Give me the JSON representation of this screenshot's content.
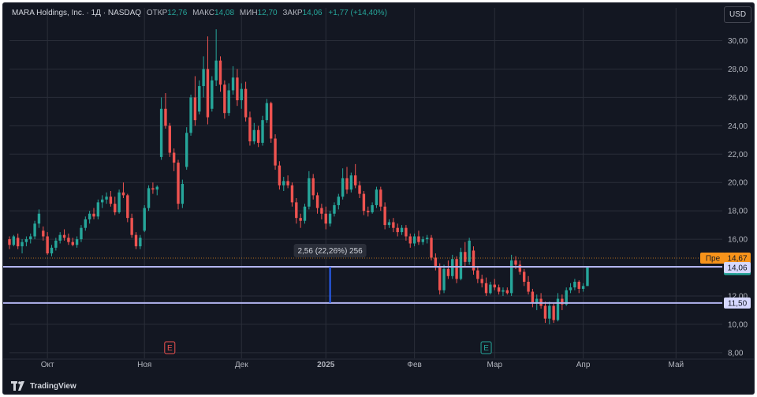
{
  "legend": {
    "name": "MARA Holdings, Inc.",
    "interval": "1Д",
    "exchange": "NASDAQ",
    "open_label": "ОТКР",
    "open": "12,76",
    "high_label": "МАКС",
    "high": "14,08",
    "low_label": "МИН",
    "low": "12,70",
    "close_label": "ЗАКР",
    "close": "14,06",
    "change": "+1,77 (+14,40%)"
  },
  "currency_button": "USD",
  "footer": {
    "brand": "TradingView",
    "icon": "tradingview-logo-icon"
  },
  "colors": {
    "background": "#131722",
    "up": "#26a69a",
    "down": "#ef5350",
    "level_line": "#b2b5f0",
    "measure": "#2962ff",
    "premarket": "#f7931a",
    "grid": "#2a2e39"
  },
  "chart_data": {
    "type": "candlestick",
    "title": "MARA Holdings, Inc. · 1Д · NASDAQ",
    "y_axis": {
      "range": [
        7.6,
        31.2
      ],
      "ticks": [
        "8,00",
        "10,00",
        "12,00",
        "14,00",
        "16,00",
        "18,00",
        "20,00",
        "22,00",
        "24,00",
        "26,00",
        "28,00",
        "30,00"
      ],
      "tick_values": [
        8,
        10,
        12,
        14,
        16,
        18,
        20,
        22,
        24,
        26,
        28,
        30
      ]
    },
    "x_axis": {
      "labels": [
        {
          "text": "Окт",
          "bar": 9,
          "bold": false
        },
        {
          "text": "Ноя",
          "bar": 32,
          "bold": false
        },
        {
          "text": "Дек",
          "bar": 55,
          "bold": false
        },
        {
          "text": "2025",
          "bar": 75,
          "bold": true
        },
        {
          "text": "Фев",
          "bar": 96,
          "bold": false
        },
        {
          "text": "Мар",
          "bar": 115,
          "bold": false
        },
        {
          "text": "Апр",
          "bar": 136,
          "bold": false
        },
        {
          "text": "Май",
          "bar": 158,
          "bold": false
        }
      ],
      "bars_total": 165
    },
    "candles": [
      [
        16.0,
        16.2,
        15.3,
        15.6
      ],
      [
        15.6,
        16.3,
        15.5,
        16.2
      ],
      [
        16.1,
        16.4,
        15.3,
        15.5
      ],
      [
        15.5,
        16.0,
        15.0,
        15.8
      ],
      [
        15.8,
        16.2,
        15.5,
        16.0
      ],
      [
        16.0,
        16.4,
        15.7,
        16.2
      ],
      [
        16.2,
        17.3,
        16.0,
        17.1
      ],
      [
        17.1,
        18.1,
        16.8,
        17.8
      ],
      [
        16.6,
        16.9,
        15.9,
        16.2
      ],
      [
        16.2,
        16.5,
        14.9,
        15.0
      ],
      [
        15.0,
        15.6,
        14.8,
        15.4
      ],
      [
        15.4,
        16.1,
        15.2,
        15.9
      ],
      [
        15.9,
        16.5,
        15.7,
        16.3
      ],
      [
        16.3,
        16.7,
        15.9,
        16.1
      ],
      [
        16.1,
        16.4,
        15.6,
        15.8
      ],
      [
        15.8,
        16.1,
        15.5,
        15.6
      ],
      [
        15.6,
        16.2,
        15.4,
        16.0
      ],
      [
        16.0,
        17.0,
        15.8,
        16.8
      ],
      [
        16.8,
        17.6,
        16.6,
        17.4
      ],
      [
        17.4,
        18.0,
        17.1,
        17.8
      ],
      [
        17.8,
        18.2,
        17.4,
        17.6
      ],
      [
        17.6,
        18.8,
        17.4,
        18.6
      ],
      [
        18.6,
        19.1,
        18.2,
        18.8
      ],
      [
        18.8,
        19.3,
        18.5,
        19.0
      ],
      [
        19.0,
        19.4,
        18.3,
        18.5
      ],
      [
        18.5,
        19.0,
        17.7,
        17.9
      ],
      [
        17.9,
        19.5,
        17.8,
        19.3
      ],
      [
        19.3,
        20.0,
        18.9,
        19.1
      ],
      [
        19.1,
        19.2,
        17.2,
        17.5
      ],
      [
        17.5,
        17.8,
        16.1,
        16.3
      ],
      [
        16.3,
        16.5,
        15.3,
        15.5
      ],
      [
        15.5,
        16.3,
        15.3,
        16.1
      ],
      [
        16.6,
        18.4,
        16.5,
        18.2
      ],
      [
        18.2,
        19.8,
        18.0,
        19.6
      ],
      [
        19.6,
        20.0,
        19.2,
        19.5
      ],
      [
        19.5,
        19.8,
        19.1,
        19.7
      ],
      [
        21.8,
        26.0,
        21.6,
        25.2
      ],
      [
        25.2,
        26.3,
        23.8,
        24.0
      ],
      [
        24.0,
        24.2,
        21.8,
        22.1
      ],
      [
        22.1,
        22.4,
        20.8,
        21.4
      ],
      [
        21.4,
        21.6,
        18.1,
        18.5
      ],
      [
        18.5,
        20.2,
        18.2,
        19.9
      ],
      [
        21.1,
        23.9,
        20.9,
        23.5
      ],
      [
        23.5,
        26.2,
        23.3,
        26.0
      ],
      [
        26.0,
        27.5,
        24.0,
        24.4
      ],
      [
        25.0,
        27.2,
        24.8,
        26.8
      ],
      [
        26.8,
        28.9,
        26.0,
        28.0
      ],
      [
        28.0,
        30.3,
        24.1,
        24.6
      ],
      [
        25.2,
        27.5,
        25.0,
        27.2
      ],
      [
        27.2,
        30.8,
        26.8,
        28.6
      ],
      [
        28.6,
        28.9,
        26.4,
        26.9
      ],
      [
        26.9,
        27.2,
        24.5,
        24.9
      ],
      [
        24.9,
        27.0,
        24.7,
        26.5
      ],
      [
        26.5,
        28.2,
        26.2,
        27.4
      ],
      [
        27.4,
        28.0,
        25.4,
        25.8
      ],
      [
        25.8,
        27.0,
        25.2,
        26.6
      ],
      [
        26.6,
        27.1,
        24.3,
        24.6
      ],
      [
        24.6,
        25.0,
        22.6,
        22.9
      ],
      [
        22.9,
        24.2,
        22.7,
        23.7
      ],
      [
        23.7,
        24.0,
        22.5,
        22.8
      ],
      [
        22.8,
        24.7,
        22.6,
        24.4
      ],
      [
        24.4,
        25.9,
        24.2,
        25.6
      ],
      [
        25.6,
        25.7,
        22.8,
        23.1
      ],
      [
        23.1,
        23.4,
        20.9,
        21.2
      ],
      [
        21.2,
        21.5,
        19.5,
        19.8
      ],
      [
        19.8,
        20.4,
        19.4,
        20.1
      ],
      [
        20.1,
        20.5,
        19.6,
        19.8
      ],
      [
        19.8,
        20.0,
        18.3,
        18.6
      ],
      [
        18.6,
        18.9,
        17.1,
        17.5
      ],
      [
        17.5,
        17.8,
        16.8,
        17.3
      ],
      [
        17.3,
        18.5,
        17.1,
        18.3
      ],
      [
        18.3,
        20.8,
        18.1,
        20.3
      ],
      [
        20.3,
        20.6,
        18.8,
        19.1
      ],
      [
        19.1,
        19.3,
        17.8,
        18.2
      ],
      [
        18.2,
        18.5,
        17.4,
        17.8
      ],
      [
        17.8,
        18.3,
        16.7,
        17.1
      ],
      [
        17.1,
        18.0,
        16.9,
        17.8
      ],
      [
        17.8,
        18.6,
        17.6,
        18.4
      ],
      [
        18.4,
        19.2,
        18.1,
        19.0
      ],
      [
        19.0,
        21.0,
        18.8,
        20.3
      ],
      [
        20.3,
        21.1,
        19.2,
        19.5
      ],
      [
        19.5,
        20.7,
        19.3,
        20.5
      ],
      [
        20.5,
        21.3,
        19.6,
        19.8
      ],
      [
        19.8,
        20.1,
        18.9,
        19.2
      ],
      [
        19.2,
        19.4,
        17.7,
        18.0
      ],
      [
        18.0,
        18.3,
        17.6,
        17.9
      ],
      [
        17.9,
        18.6,
        17.8,
        18.4
      ],
      [
        18.4,
        19.7,
        18.2,
        19.5
      ],
      [
        19.5,
        19.7,
        18.0,
        18.3
      ],
      [
        18.3,
        18.6,
        16.7,
        17.0
      ],
      [
        17.0,
        17.4,
        16.8,
        17.2
      ],
      [
        17.2,
        17.5,
        16.5,
        16.8
      ],
      [
        16.8,
        17.1,
        16.2,
        16.5
      ],
      [
        16.5,
        17.0,
        16.3,
        16.8
      ],
      [
        16.8,
        17.0,
        15.9,
        16.2
      ],
      [
        16.2,
        16.4,
        15.4,
        15.7
      ],
      [
        15.7,
        16.4,
        15.5,
        16.2
      ],
      [
        16.2,
        16.6,
        15.6,
        15.8
      ],
      [
        15.8,
        16.2,
        15.6,
        16.0
      ],
      [
        16.0,
        16.3,
        15.7,
        16.1
      ],
      [
        16.1,
        16.3,
        14.5,
        14.7
      ],
      [
        14.7,
        15.0,
        13.8,
        14.1
      ],
      [
        14.1,
        14.3,
        12.1,
        12.4
      ],
      [
        12.4,
        14.2,
        12.2,
        13.9
      ],
      [
        13.9,
        14.5,
        13.2,
        13.4
      ],
      [
        13.4,
        14.9,
        13.2,
        14.6
      ],
      [
        14.6,
        14.8,
        12.9,
        13.2
      ],
      [
        13.2,
        15.4,
        13.1,
        15.1
      ],
      [
        15.1,
        15.8,
        14.1,
        14.4
      ],
      [
        14.4,
        16.1,
        14.2,
        15.9
      ],
      [
        15.2,
        15.5,
        13.5,
        13.8
      ],
      [
        13.8,
        14.0,
        12.9,
        13.2
      ],
      [
        13.2,
        13.5,
        12.6,
        12.9
      ],
      [
        12.9,
        13.3,
        12.0,
        12.2
      ],
      [
        12.2,
        13.0,
        12.1,
        12.8
      ],
      [
        12.8,
        13.2,
        12.4,
        12.6
      ],
      [
        12.6,
        12.8,
        12.1,
        12.3
      ],
      [
        12.3,
        12.6,
        12.0,
        12.4
      ],
      [
        12.4,
        12.6,
        12.1,
        12.2
      ],
      [
        12.2,
        14.9,
        12.0,
        14.5
      ],
      [
        14.5,
        14.8,
        13.9,
        14.2
      ],
      [
        14.2,
        14.5,
        13.5,
        13.7
      ],
      [
        13.7,
        13.9,
        12.7,
        13.0
      ],
      [
        13.0,
        13.4,
        12.1,
        12.3
      ],
      [
        12.3,
        12.5,
        11.2,
        11.5
      ],
      [
        11.5,
        12.1,
        11.0,
        11.8
      ],
      [
        11.8,
        12.2,
        11.1,
        11.3
      ],
      [
        11.3,
        11.6,
        10.1,
        10.4
      ],
      [
        10.4,
        11.6,
        10.0,
        11.3
      ],
      [
        11.3,
        11.5,
        10.1,
        10.3
      ],
      [
        10.3,
        12.2,
        10.2,
        11.8
      ],
      [
        11.8,
        12.1,
        11.0,
        11.4
      ],
      [
        11.4,
        12.6,
        11.3,
        12.4
      ],
      [
        12.4,
        12.9,
        12.2,
        12.6
      ],
      [
        12.6,
        13.2,
        12.4,
        13.0
      ],
      [
        13.0,
        13.1,
        12.2,
        12.5
      ],
      [
        12.5,
        12.9,
        12.3,
        12.7
      ],
      [
        12.7,
        14.08,
        12.7,
        14.06
      ]
    ],
    "levels": [
      {
        "value": 14.06,
        "label": "14,06"
      },
      {
        "value": 11.5,
        "label": "11,50"
      }
    ],
    "measure": {
      "bar": 76,
      "from": 11.5,
      "to": 14.06,
      "label": "2,56 (22,26%) 256"
    },
    "premarket": {
      "value": 14.67,
      "label_prefix": "Пре",
      "label": "14,67"
    },
    "last_price": {
      "value": 14.06,
      "label": "14,06"
    },
    "dotted_line": {
      "value": 14.67
    },
    "events": [
      {
        "bar": 38,
        "label": "E",
        "color": "#ef5350"
      },
      {
        "bar": 113,
        "label": "E",
        "color": "#26a69a"
      }
    ]
  }
}
